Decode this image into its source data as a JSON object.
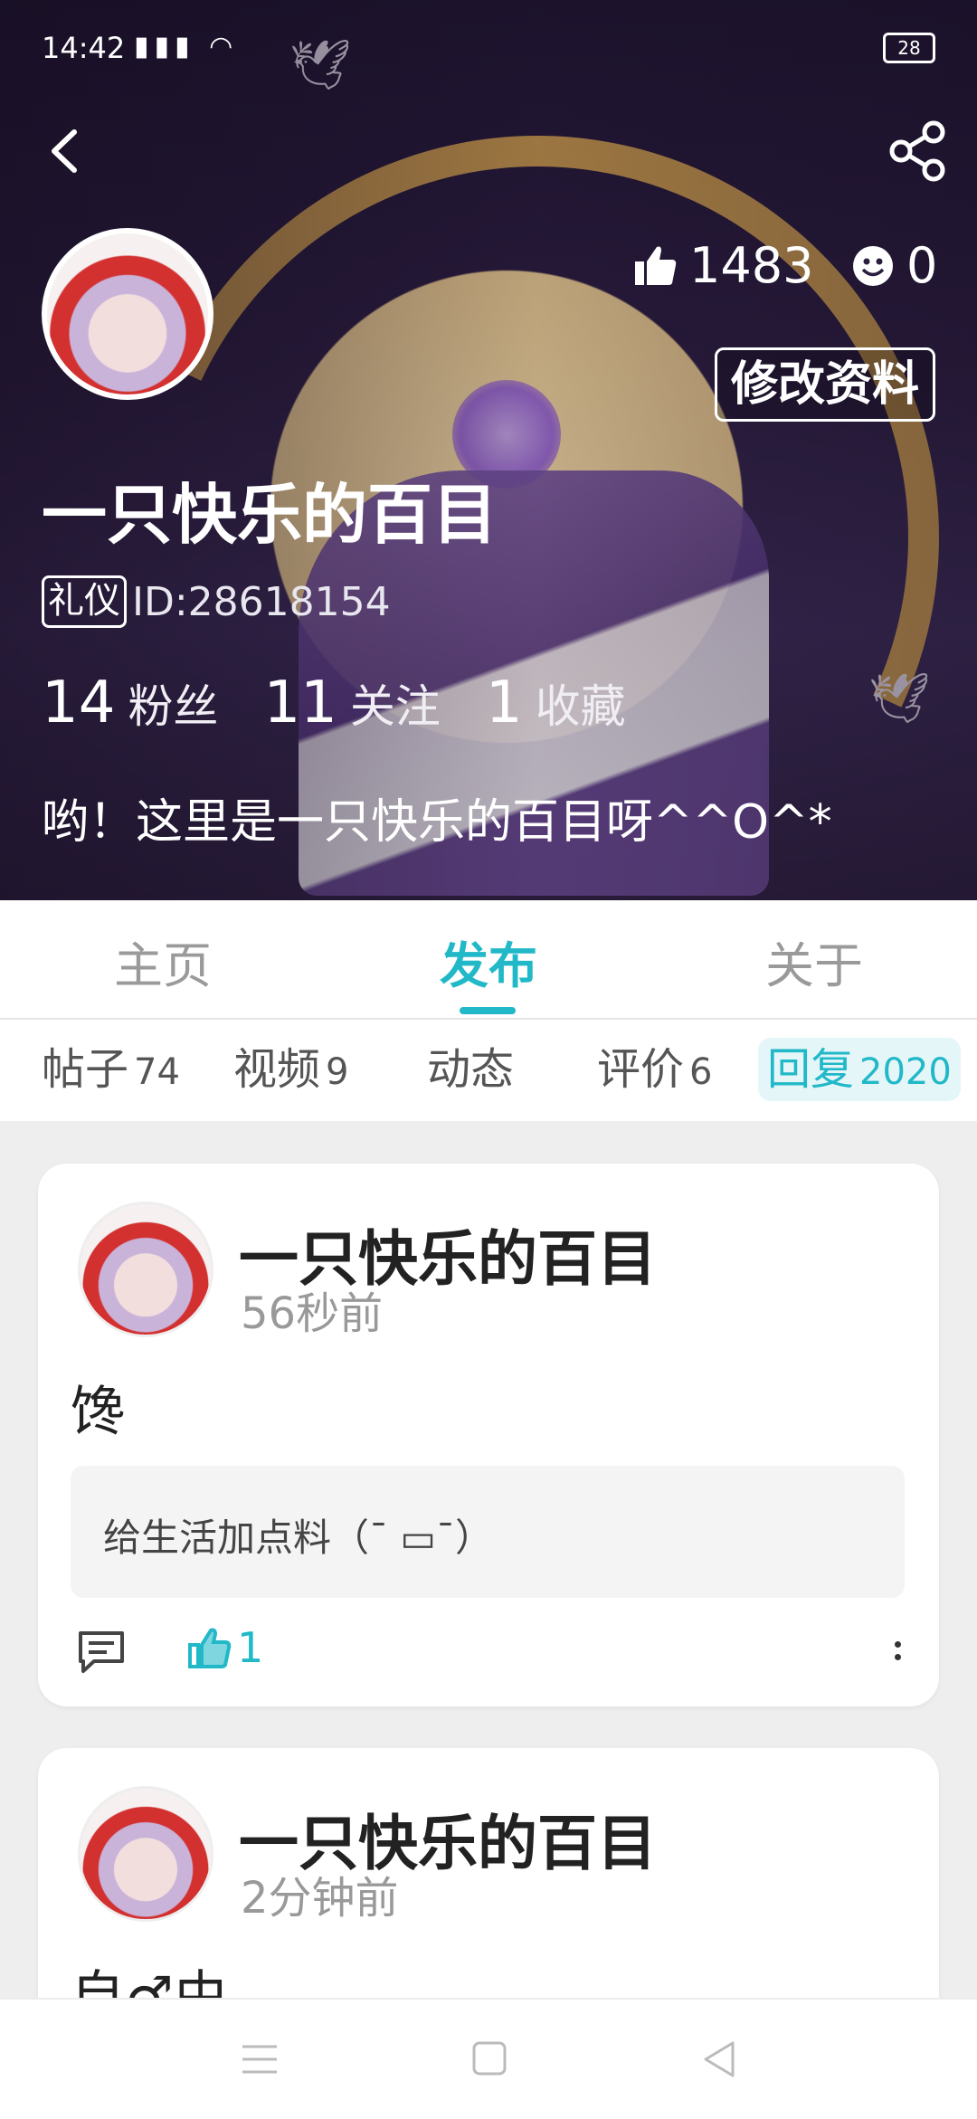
{
  "status_bar": {
    "time": "14:42",
    "network": "4G",
    "battery": "28"
  },
  "profile": {
    "name": "一只快乐的百目",
    "badge": "礼仪",
    "id_text": "ID:28618154",
    "likes": "1483",
    "faces": "0",
    "edit_button": "修改资料",
    "stats": [
      {
        "num": "14",
        "label": "粉丝"
      },
      {
        "num": "11",
        "label": "关注"
      },
      {
        "num": "1",
        "label": "收藏"
      }
    ],
    "bio": "哟！这里是一只快乐的百目呀^^O^*"
  },
  "tabs": [
    "主页",
    "发布",
    "关于"
  ],
  "active_tab": "发布",
  "subtabs": [
    {
      "label": "帖子",
      "count": "74"
    },
    {
      "label": "视频",
      "count": "9"
    },
    {
      "label": "动态",
      "count": ""
    },
    {
      "label": "评价",
      "count": "6"
    },
    {
      "label": "回复",
      "count": "2020"
    }
  ],
  "posts": [
    {
      "author": "一只快乐的百目",
      "time": "56秒前",
      "content": "馋",
      "quote": "给生活加点料（¯ ▭¯）",
      "likes": "1"
    },
    {
      "author": "一只快乐的百目",
      "time": "2分钟前",
      "content": "自♂由"
    }
  ],
  "colors": {
    "accent": "#21b8c8"
  }
}
